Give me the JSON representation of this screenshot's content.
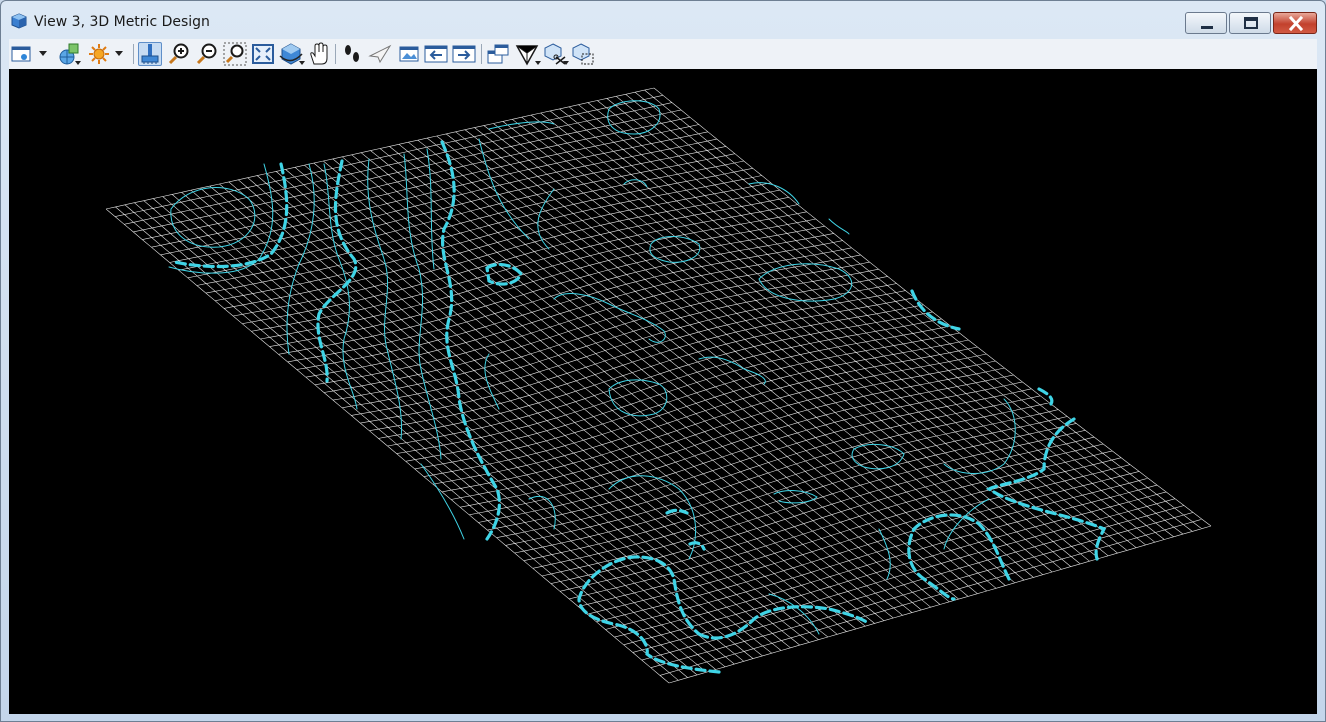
{
  "window": {
    "title": "View 3, 3D Metric Design",
    "controls": {
      "minimize": "minimize",
      "maximize": "maximize",
      "close": "close"
    }
  },
  "toolbar": {
    "items": [
      {
        "name": "view-attributes-icon",
        "dropdown": true
      },
      {
        "name": "display-style-icon",
        "dropdown": true
      },
      {
        "name": "view-lighting-icon",
        "dropdown": true
      },
      {
        "name": "update-view-icon",
        "active": true
      },
      {
        "name": "zoom-in-icon"
      },
      {
        "name": "zoom-out-icon"
      },
      {
        "name": "window-area-icon"
      },
      {
        "name": "fit-view-icon"
      },
      {
        "name": "rotate-view-icon",
        "dropdown": true
      },
      {
        "name": "pan-view-icon"
      },
      {
        "name": "walk-icon"
      },
      {
        "name": "fly-icon"
      },
      {
        "name": "view-photo-icon"
      },
      {
        "name": "view-previous-icon"
      },
      {
        "name": "view-next-icon"
      },
      {
        "name": "copy-view-icon"
      },
      {
        "name": "view-clip-icon",
        "dropdown": true
      },
      {
        "name": "clip-volume-icon",
        "dropdown": true
      },
      {
        "name": "clip-mask-icon"
      }
    ]
  },
  "colors": {
    "viewport_background": "#000000",
    "mesh": "#ffffff",
    "contour": "#3fd4e6"
  }
}
